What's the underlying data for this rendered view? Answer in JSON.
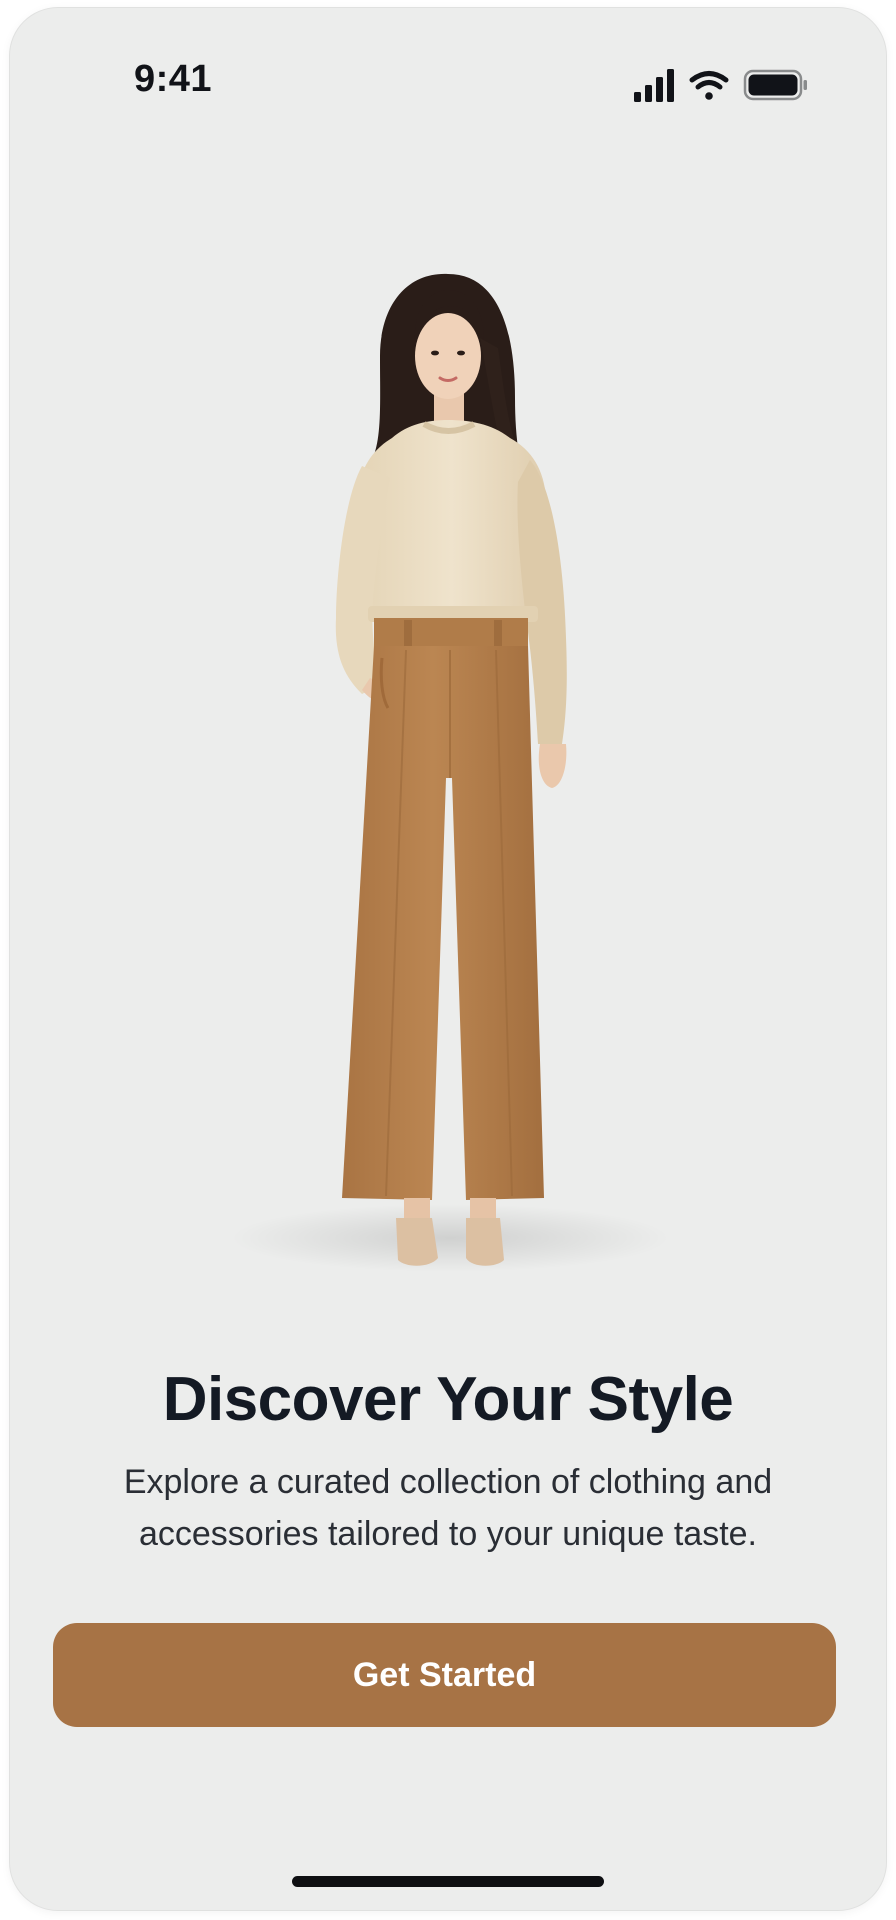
{
  "status_bar": {
    "time": "9:41",
    "icons": [
      "cellular-signal-icon",
      "wifi-icon",
      "battery-icon"
    ]
  },
  "hero": {
    "illustration": "model-full-body-outfit"
  },
  "onboarding": {
    "title": "Discover Your Style",
    "subtitle": "Explore a curated collection of clothing and accessories tailored to your unique taste.",
    "cta_label": "Get Started"
  },
  "colors": {
    "background": "#ecedec",
    "accent": "#a77345",
    "title": "#141a24",
    "body_text": "#2a2e35",
    "sweater": "#eadcc1",
    "trousers": "#b27f4c"
  }
}
